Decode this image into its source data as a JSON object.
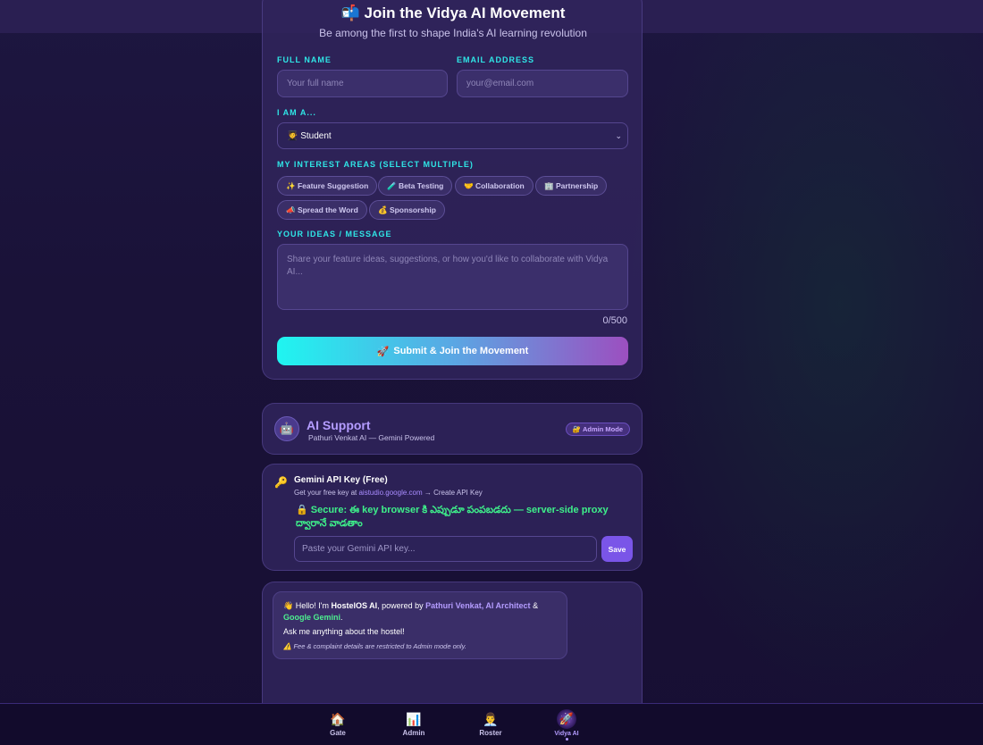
{
  "form": {
    "title_icon": "📬",
    "title": "Join the Vidya AI Movement",
    "subtitle": "Be among the first to shape India's AI learning revolution",
    "full_name_label": "FULL NAME",
    "full_name_placeholder": "Your full name",
    "full_name_value": "",
    "email_label": "EMAIL ADDRESS",
    "email_placeholder": "your@email.com",
    "email_value": "",
    "role_label": "I AM A...",
    "role_selected": "🧑‍🎓 Student",
    "interests_label": "MY INTEREST AREAS (SELECT MULTIPLE)",
    "chips": [
      "✨ Feature Suggestion",
      "🧪 Beta Testing",
      "🤝 Collaboration",
      "🏢 Partnership",
      "📣 Spread the Word",
      "💰 Sponsorship"
    ],
    "message_label": "YOUR IDEAS / MESSAGE",
    "message_placeholder": "Share your feature ideas, suggestions, or how you'd like to collaborate with Vidya AI...",
    "counter": "0/500",
    "submit_icon": "🚀",
    "submit_label": "Submit & Join the Movement"
  },
  "support": {
    "avatar_icon": "🤖",
    "title": "AI Support",
    "subtitle": "Pathuri Venkat AI — Gemini Powered",
    "admin_badge": "🔐 Admin Mode"
  },
  "api": {
    "key_icon": "🔑",
    "title": "Gemini API Key (Free)",
    "hint_prefix": "Get your free key at ",
    "hint_link": "aistudio.google.com",
    "hint_suffix": " → Create API Key",
    "secure_note": "🔒 Secure: ఈ key browser కి ఎప్పుడూ పంపబడదు — server-side proxy ద్వారానే వాడతాం",
    "input_placeholder": "Paste your Gemini API key...",
    "save_label": "Save"
  },
  "chat": {
    "greeting_wave": "👋",
    "greeting_prefix": " Hello! I'm ",
    "bot_name": "HostelOS AI",
    "powered_by": ", powered by ",
    "author": "Pathuri Venkat",
    "author_sep": ", ",
    "author_role": "AI Architect",
    "amp": " & ",
    "engine": "Google Gemini",
    "period": ".",
    "ask": "Ask me anything about the hostel!",
    "warning_icon": "⚠️",
    "warning": "Fee & complaint details are restricted to Admin mode only."
  },
  "nav": {
    "items": [
      {
        "icon": "🏠",
        "label": "Gate"
      },
      {
        "icon": "📊",
        "label": "Admin"
      },
      {
        "icon": "👨‍💼",
        "label": "Roster"
      },
      {
        "icon": "🚀",
        "label": "Vidya AI"
      }
    ],
    "active": "Vidya AI"
  },
  "colors": {
    "accent_cyan": "#2fe6e6",
    "accent_purple": "#b49cff",
    "secure_green": "#3ef08a",
    "save_button": "#7a55e8"
  }
}
